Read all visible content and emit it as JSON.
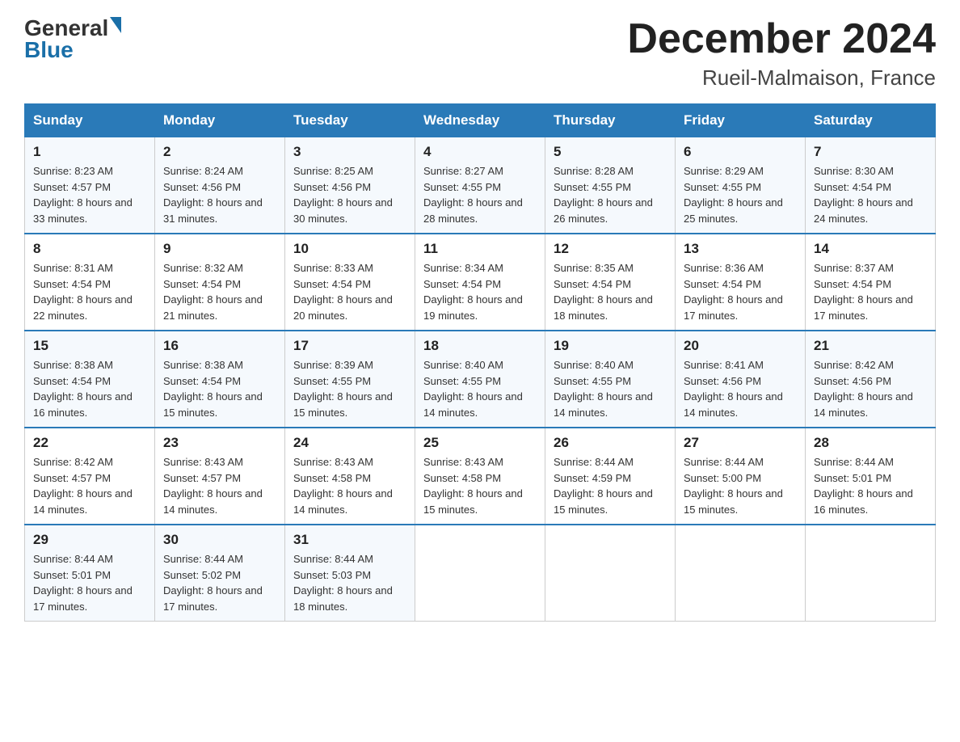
{
  "header": {
    "logo_general": "General",
    "logo_blue": "Blue",
    "month_title": "December 2024",
    "location": "Rueil-Malmaison, France"
  },
  "weekdays": [
    "Sunday",
    "Monday",
    "Tuesday",
    "Wednesday",
    "Thursday",
    "Friday",
    "Saturday"
  ],
  "weeks": [
    [
      {
        "day": "1",
        "sunrise": "8:23 AM",
        "sunset": "4:57 PM",
        "daylight": "8 hours and 33 minutes."
      },
      {
        "day": "2",
        "sunrise": "8:24 AM",
        "sunset": "4:56 PM",
        "daylight": "8 hours and 31 minutes."
      },
      {
        "day": "3",
        "sunrise": "8:25 AM",
        "sunset": "4:56 PM",
        "daylight": "8 hours and 30 minutes."
      },
      {
        "day": "4",
        "sunrise": "8:27 AM",
        "sunset": "4:55 PM",
        "daylight": "8 hours and 28 minutes."
      },
      {
        "day": "5",
        "sunrise": "8:28 AM",
        "sunset": "4:55 PM",
        "daylight": "8 hours and 26 minutes."
      },
      {
        "day": "6",
        "sunrise": "8:29 AM",
        "sunset": "4:55 PM",
        "daylight": "8 hours and 25 minutes."
      },
      {
        "day": "7",
        "sunrise": "8:30 AM",
        "sunset": "4:54 PM",
        "daylight": "8 hours and 24 minutes."
      }
    ],
    [
      {
        "day": "8",
        "sunrise": "8:31 AM",
        "sunset": "4:54 PM",
        "daylight": "8 hours and 22 minutes."
      },
      {
        "day": "9",
        "sunrise": "8:32 AM",
        "sunset": "4:54 PM",
        "daylight": "8 hours and 21 minutes."
      },
      {
        "day": "10",
        "sunrise": "8:33 AM",
        "sunset": "4:54 PM",
        "daylight": "8 hours and 20 minutes."
      },
      {
        "day": "11",
        "sunrise": "8:34 AM",
        "sunset": "4:54 PM",
        "daylight": "8 hours and 19 minutes."
      },
      {
        "day": "12",
        "sunrise": "8:35 AM",
        "sunset": "4:54 PM",
        "daylight": "8 hours and 18 minutes."
      },
      {
        "day": "13",
        "sunrise": "8:36 AM",
        "sunset": "4:54 PM",
        "daylight": "8 hours and 17 minutes."
      },
      {
        "day": "14",
        "sunrise": "8:37 AM",
        "sunset": "4:54 PM",
        "daylight": "8 hours and 17 minutes."
      }
    ],
    [
      {
        "day": "15",
        "sunrise": "8:38 AM",
        "sunset": "4:54 PM",
        "daylight": "8 hours and 16 minutes."
      },
      {
        "day": "16",
        "sunrise": "8:38 AM",
        "sunset": "4:54 PM",
        "daylight": "8 hours and 15 minutes."
      },
      {
        "day": "17",
        "sunrise": "8:39 AM",
        "sunset": "4:55 PM",
        "daylight": "8 hours and 15 minutes."
      },
      {
        "day": "18",
        "sunrise": "8:40 AM",
        "sunset": "4:55 PM",
        "daylight": "8 hours and 14 minutes."
      },
      {
        "day": "19",
        "sunrise": "8:40 AM",
        "sunset": "4:55 PM",
        "daylight": "8 hours and 14 minutes."
      },
      {
        "day": "20",
        "sunrise": "8:41 AM",
        "sunset": "4:56 PM",
        "daylight": "8 hours and 14 minutes."
      },
      {
        "day": "21",
        "sunrise": "8:42 AM",
        "sunset": "4:56 PM",
        "daylight": "8 hours and 14 minutes."
      }
    ],
    [
      {
        "day": "22",
        "sunrise": "8:42 AM",
        "sunset": "4:57 PM",
        "daylight": "8 hours and 14 minutes."
      },
      {
        "day": "23",
        "sunrise": "8:43 AM",
        "sunset": "4:57 PM",
        "daylight": "8 hours and 14 minutes."
      },
      {
        "day": "24",
        "sunrise": "8:43 AM",
        "sunset": "4:58 PM",
        "daylight": "8 hours and 14 minutes."
      },
      {
        "day": "25",
        "sunrise": "8:43 AM",
        "sunset": "4:58 PM",
        "daylight": "8 hours and 15 minutes."
      },
      {
        "day": "26",
        "sunrise": "8:44 AM",
        "sunset": "4:59 PM",
        "daylight": "8 hours and 15 minutes."
      },
      {
        "day": "27",
        "sunrise": "8:44 AM",
        "sunset": "5:00 PM",
        "daylight": "8 hours and 15 minutes."
      },
      {
        "day": "28",
        "sunrise": "8:44 AM",
        "sunset": "5:01 PM",
        "daylight": "8 hours and 16 minutes."
      }
    ],
    [
      {
        "day": "29",
        "sunrise": "8:44 AM",
        "sunset": "5:01 PM",
        "daylight": "8 hours and 17 minutes."
      },
      {
        "day": "30",
        "sunrise": "8:44 AM",
        "sunset": "5:02 PM",
        "daylight": "8 hours and 17 minutes."
      },
      {
        "day": "31",
        "sunrise": "8:44 AM",
        "sunset": "5:03 PM",
        "daylight": "8 hours and 18 minutes."
      },
      null,
      null,
      null,
      null
    ]
  ]
}
